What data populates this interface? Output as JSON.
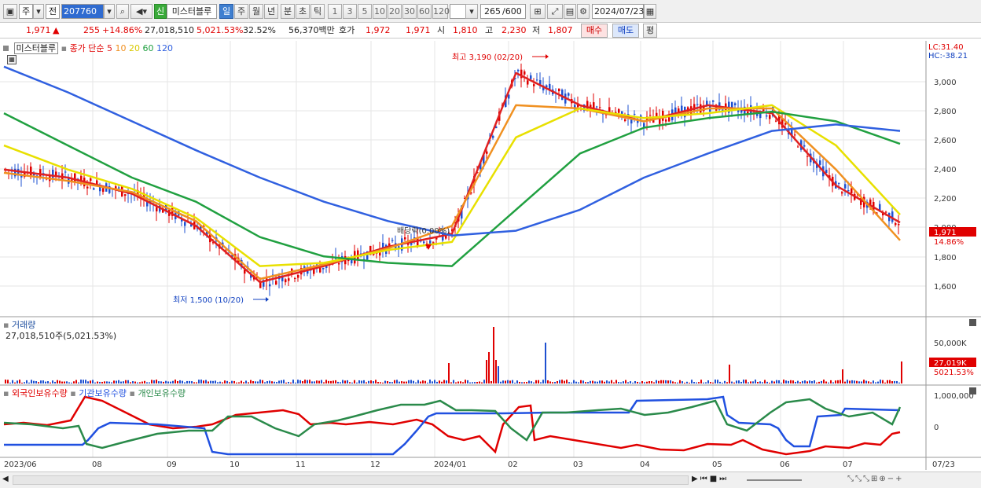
{
  "toolbar": {
    "market_label": "주",
    "prev_label": "전",
    "stock_code": "207760",
    "badge_label": "신",
    "stock_name": "미스터블루",
    "periods": [
      "일",
      "주",
      "월",
      "년",
      "분",
      "초",
      "틱"
    ],
    "selected_period": "일",
    "intervals": [
      "1",
      "3",
      "5",
      "10",
      "20",
      "30",
      "60",
      "120"
    ],
    "count_value": "265",
    "count_max": "/600",
    "date_value": "2024/07/23"
  },
  "quote": {
    "price": "1,971",
    "change_arrow": "▲",
    "change": "255",
    "change_pct": "+14.86%",
    "volume": "27,018,510",
    "volume_pct": "5,021.53%",
    "turnover_pct": "32.52%",
    "amount": "56,370백만",
    "ask_label": "호가",
    "ask": "1,972",
    "bid": "1,971",
    "open_label": "시",
    "open": "1,810",
    "high_label": "고",
    "high": "2,230",
    "low_label": "저",
    "low": "1,807",
    "buy_button": "매수",
    "sell_button": "매도",
    "eval_button": "평"
  },
  "price_panel": {
    "name_tag": "미스터블루",
    "ma_label": "종가 단순",
    "ma_periods": [
      "5",
      "10",
      "20",
      "60",
      "120"
    ],
    "ma_colors": [
      "#e02020",
      "#f09020",
      "#e8e000",
      "#20a040",
      "#3060e0"
    ],
    "lc": "LC:31.40",
    "hc": "HC:-38.21",
    "y_ticks": [
      "3,000",
      "2,800",
      "2,600",
      "2,400",
      "2,200",
      "2,000",
      "1,800",
      "1,600"
    ],
    "current_tag": "1,971",
    "current_pct": "14.86%",
    "high_note": "최고 3,190 (02/20)",
    "low_note": "최저 1,500 (10/20)",
    "dividend_note": "배당락(0.00%)"
  },
  "volume_panel": {
    "title": "거래량",
    "value_text": "27,018,510주(5,021.53%)",
    "y_tick": "50,000K",
    "current_tag": "27,019K",
    "current_pct": "5021.53%"
  },
  "holding_panel": {
    "series": [
      "외국인보유수량",
      "기관보유수량",
      "개인보유수량"
    ],
    "series_colors": [
      "#e00000",
      "#2050e0",
      "#2a8a4a"
    ],
    "y_ticks": [
      "1,000,000",
      "0"
    ]
  },
  "x_axis": {
    "labels": [
      "2023/06",
      "08",
      "09",
      "10",
      "11",
      "12",
      "2024/01",
      "02",
      "03",
      "04",
      "05",
      "06",
      "07"
    ],
    "right_label": "07/23"
  },
  "chart_data": {
    "type": "line",
    "title": "",
    "ylabel": "",
    "ylim": [
      1400,
      3100
    ],
    "x": [
      "2023/06",
      "2023/07",
      "2023/08",
      "2023/09",
      "2023/10",
      "2023/11",
      "2023/12",
      "2024/01",
      "2024/02",
      "2024/03",
      "2024/04",
      "2024/05",
      "2024/06",
      "2024/07",
      "2024/07/23"
    ],
    "series": [
      {
        "name": "5",
        "values": [
          2300,
          2250,
          2150,
          1950,
          1600,
          1700,
          1820,
          1900,
          2900,
          2700,
          2600,
          2700,
          2650,
          2200,
          1971
        ]
      },
      {
        "name": "10",
        "values": [
          2280,
          2230,
          2160,
          1980,
          1620,
          1710,
          1810,
          1950,
          2700,
          2680,
          2600,
          2680,
          2680,
          2300,
          1860
        ]
      },
      {
        "name": "20",
        "values": [
          2450,
          2300,
          2180,
          2000,
          1700,
          1720,
          1800,
          1850,
          2500,
          2680,
          2620,
          2650,
          2700,
          2450,
          2020
        ]
      },
      {
        "name": "60",
        "values": [
          2650,
          2450,
          2250,
          2100,
          1880,
          1760,
          1720,
          1700,
          2050,
          2400,
          2560,
          2620,
          2660,
          2600,
          2460
        ]
      },
      {
        "name": "120",
        "values": [
          2940,
          2780,
          2600,
          2420,
          2250,
          2100,
          1980,
          1890,
          1920,
          2050,
          2250,
          2400,
          2540,
          2580,
          2540
        ]
      }
    ]
  }
}
